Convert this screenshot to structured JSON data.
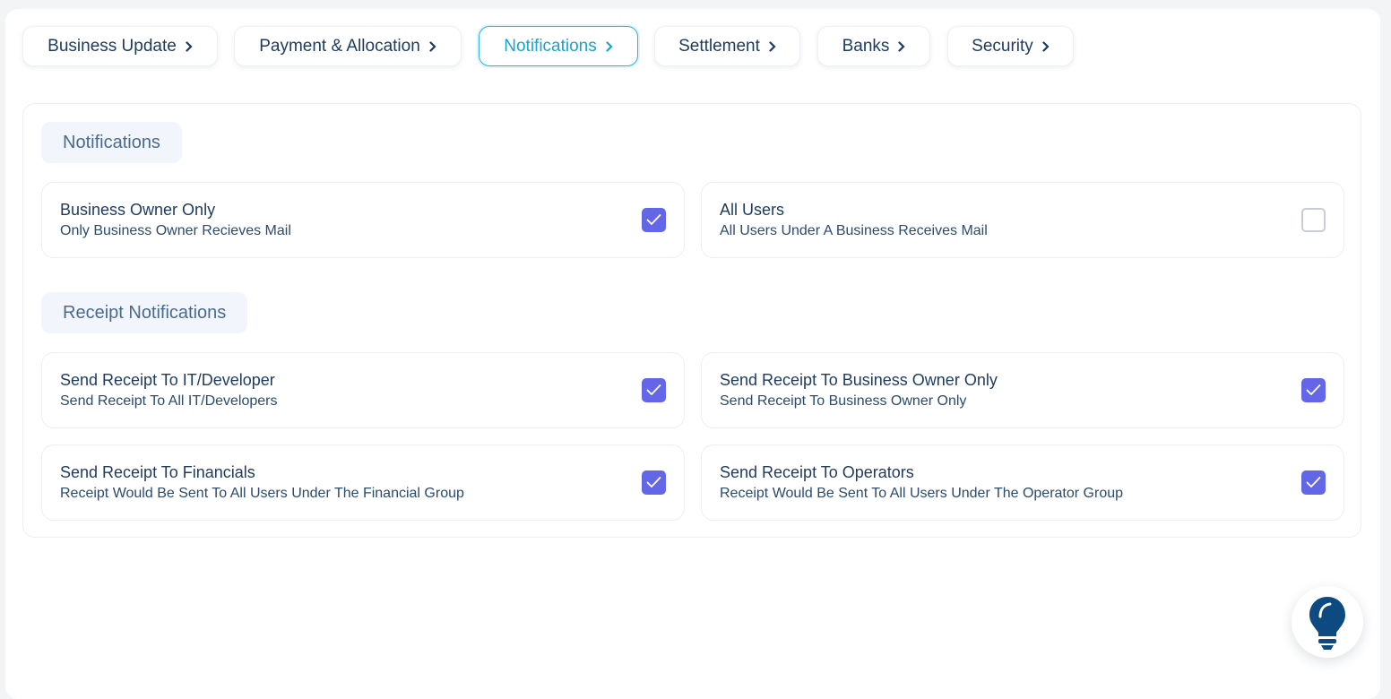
{
  "tabs": [
    {
      "label": "Business Update"
    },
    {
      "label": "Payment & Allocation"
    },
    {
      "label": "Notifications",
      "active": true
    },
    {
      "label": "Settlement"
    },
    {
      "label": "Banks"
    },
    {
      "label": "Security"
    }
  ],
  "notifications": {
    "heading": "Notifications",
    "options": [
      {
        "title": "Business Owner Only",
        "description": "Only Business Owner Recieves Mail",
        "checked": true
      },
      {
        "title": "All Users",
        "description": "All Users Under A Business Receives Mail",
        "checked": false
      }
    ]
  },
  "receipt_notifications": {
    "heading": "Receipt Notifications",
    "options": [
      {
        "title": "Send Receipt To IT/Developer",
        "description": "Send Receipt To All IT/Developers",
        "checked": true
      },
      {
        "title": "Send Receipt To Business Owner Only",
        "description": "Send Receipt To Business Owner Only",
        "checked": true
      },
      {
        "title": "Send Receipt To Financials",
        "description": "Receipt Would Be Sent To All Users Under The Financial Group",
        "checked": true
      },
      {
        "title": "Send Receipt To Operators",
        "description": "Receipt Would Be Sent To All Users Under The Operator Group",
        "checked": true
      }
    ]
  },
  "colors": {
    "accent": "#6366e6",
    "active_tab": "#1aa3d0",
    "text": "#1e3a5f",
    "bulb": "#0d4a80"
  },
  "help": {
    "icon": "lightbulb-icon"
  }
}
